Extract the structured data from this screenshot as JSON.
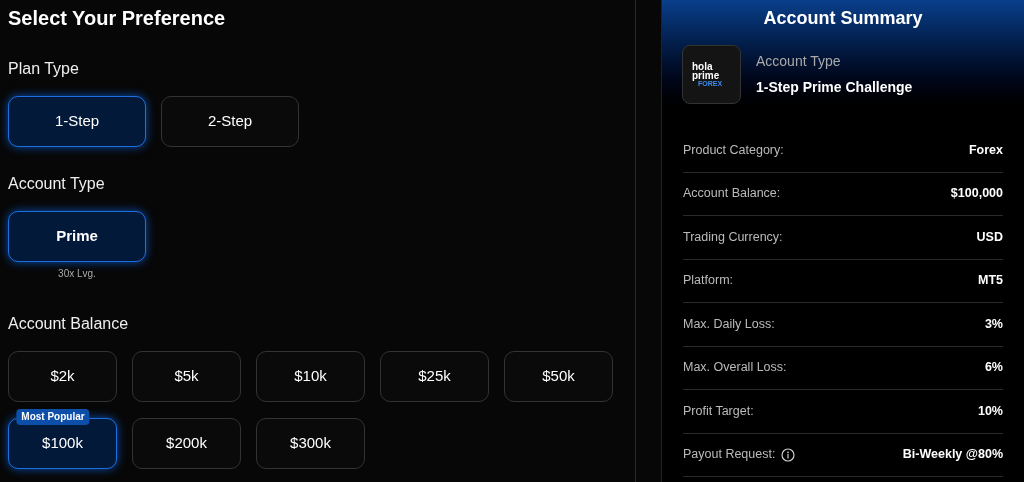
{
  "preference": {
    "title": "Select Your Preference",
    "sections": [
      {
        "label": "Plan Type",
        "options": [
          {
            "label": "1-Step",
            "selected": true
          },
          {
            "label": "2-Step",
            "selected": false
          }
        ]
      },
      {
        "label": "Account Type",
        "options": [
          {
            "label": "Prime",
            "selected": true,
            "note": "30x Lvg."
          }
        ]
      },
      {
        "label": "Account Balance",
        "options": [
          {
            "label": "$2k",
            "selected": false
          },
          {
            "label": "$5k",
            "selected": false
          },
          {
            "label": "$10k",
            "selected": false
          },
          {
            "label": "$25k",
            "selected": false
          },
          {
            "label": "$50k",
            "selected": false
          },
          {
            "label": "$100k",
            "selected": true,
            "badge": "Most Popular"
          },
          {
            "label": "$200k",
            "selected": false
          },
          {
            "label": "$300k",
            "selected": false
          }
        ]
      }
    ]
  },
  "summary": {
    "title": "Account Summary",
    "logo": {
      "line_1": "hola",
      "line_2": "prime",
      "line_3": "FOREX"
    },
    "account_type_label": "Account Type",
    "account_type": "1-Step Prime Challenge",
    "rows": [
      {
        "label": "Product Category:",
        "value": "Forex"
      },
      {
        "label": "Account Balance:",
        "value": "$100,000"
      },
      {
        "label": "Trading Currency:",
        "value": "USD"
      },
      {
        "label": "Platform:",
        "value": "MT5"
      },
      {
        "label": "Max. Daily Loss:",
        "value": "3%"
      },
      {
        "label": "Max. Overall Loss:",
        "value": "6%"
      },
      {
        "label": "Profit Target:",
        "value": "10%"
      },
      {
        "label": "Payout Request:",
        "value": "Bi-Weekly @80%",
        "info": true
      }
    ]
  }
}
